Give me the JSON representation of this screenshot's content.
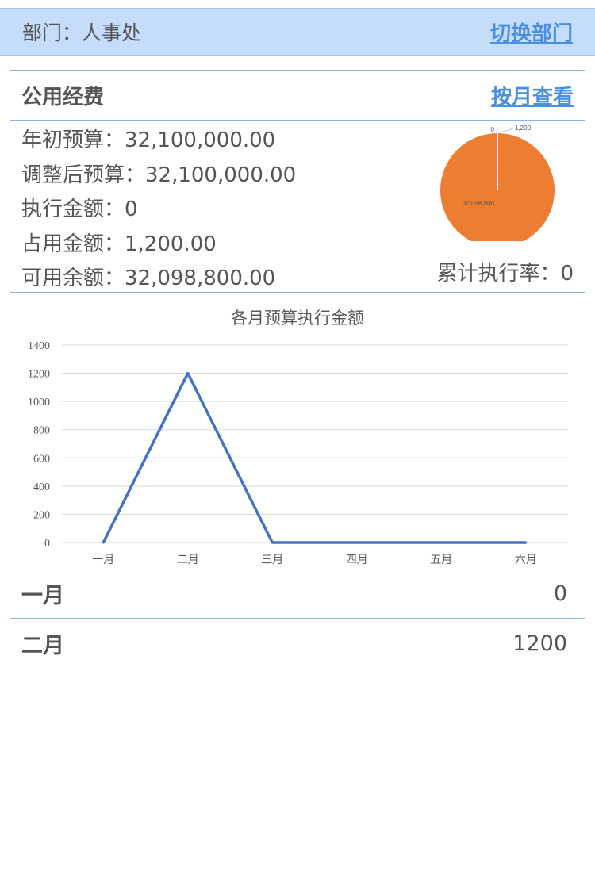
{
  "header": {
    "department_label": "部门：人事处",
    "switch_label": "切换部门"
  },
  "card": {
    "title": "公用经费",
    "monthly_link": "按月查看",
    "info": [
      "年初预算：32,100,000.00",
      "调整后预算：32,100,000.00",
      "执行金额：0",
      "占用金额：1,200.00",
      "可用余额：32,098,800.00"
    ],
    "rate_label": "累计执行率：0"
  },
  "pie": {
    "slices": [
      {
        "label": "0",
        "value": 0
      },
      {
        "label": "1,200",
        "value": 1200
      },
      {
        "label": "32,098,800",
        "value": 32098800
      }
    ],
    "main_color": "#ed7d31",
    "line_color": "#ffffff"
  },
  "chart_data": {
    "type": "line",
    "title": "各月预算执行金额",
    "categories": [
      "一月",
      "二月",
      "三月",
      "四月",
      "五月",
      "六月"
    ],
    "series": [
      {
        "values": [
          0,
          1200,
          0,
          0,
          0,
          0
        ],
        "color": "#4472c4"
      }
    ],
    "ylim": [
      0,
      1400
    ],
    "yticks": [
      0,
      200,
      400,
      600,
      800,
      1000,
      1200,
      1400
    ],
    "grid": true,
    "xlabel": "",
    "ylabel": ""
  },
  "months": [
    {
      "month": "一月",
      "value": "0"
    },
    {
      "month": "二月",
      "value": "1200"
    }
  ]
}
